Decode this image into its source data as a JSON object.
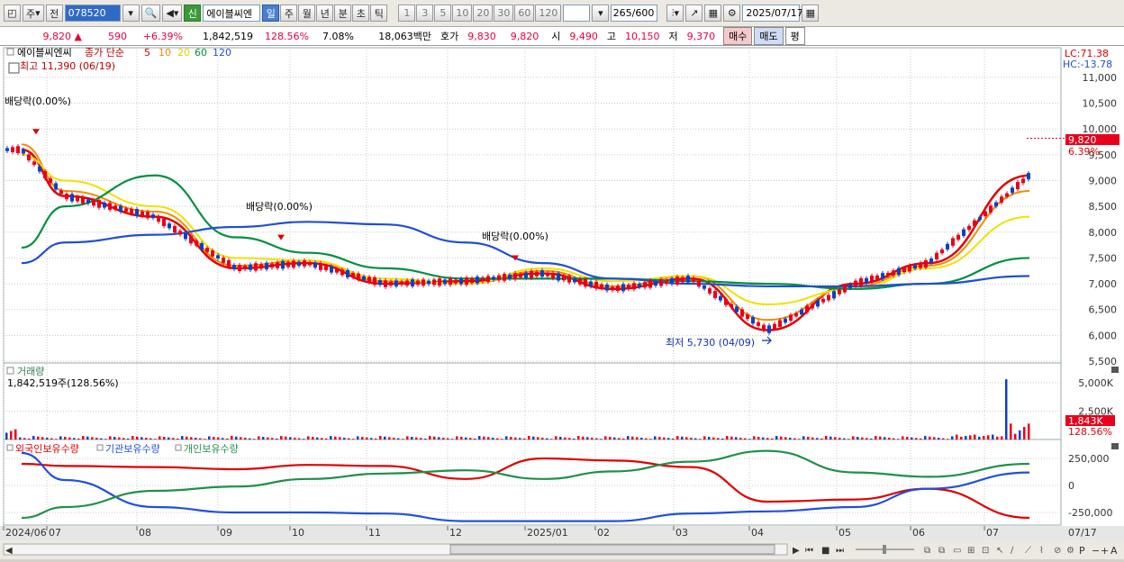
{
  "toolbar": {
    "period_label": "주",
    "prev_label": "전",
    "stock_code": "078520",
    "new_badge": "신",
    "stock_name": "에이블씨엔",
    "periods": [
      "일",
      "주",
      "월",
      "년",
      "분",
      "초",
      "틱"
    ],
    "active_period": "일",
    "intervals": [
      "1",
      "3",
      "5",
      "10",
      "20",
      "30",
      "60",
      "120"
    ],
    "count": "265",
    "count_total": "/600",
    "date": "2025/07/17"
  },
  "quote": {
    "price": "9,820",
    "change_arrow": "▲",
    "change": "590",
    "change_pct": "+6.39%",
    "volume": "1,842,519",
    "volume_ratio": "128.56%",
    "turnover": "7.08%",
    "amount": "18,063백만",
    "ask_label": "호가",
    "ask": "9,830",
    "bid": "9,820",
    "open_label": "시",
    "open": "9,490",
    "high_label": "고",
    "high": "10,150",
    "low_label": "저",
    "low": "9,370",
    "buy_label": "매수",
    "sell_label": "매도",
    "avg_label": "평"
  },
  "legend": {
    "name": "에이블씨엔씨",
    "ma_label": "종가 단순",
    "ma_periods": [
      "5",
      "10",
      "20",
      "60",
      "120"
    ],
    "ma_colors": [
      "#e00000",
      "#f08c00",
      "#f0e000",
      "#009040",
      "#2050d0"
    ]
  },
  "price_panel": {
    "lc_label": "LC:71.38",
    "hc_label": "HC:-13.78",
    "high_annotation": "최고 11,390 (06/19)",
    "low_annotation": "최저 5,730 (04/09)",
    "dividend_labels": [
      "배당락(0.00%)",
      "배당락(0.00%)",
      "배당락(0.00%)"
    ],
    "current_price_tag": "9,820",
    "current_pct_tag": "6.39%"
  },
  "volume_panel": {
    "title": "거래량",
    "value_label": "1,842,519주(128.56%)",
    "current_tag": "1,843K",
    "current_pct_tag": "128.56%"
  },
  "holdings_panel": {
    "series_labels": [
      "외국인보유수량",
      "기관보유수량",
      "개인보유수량"
    ],
    "series_colors": [
      "#e00000",
      "#2050e0",
      "#20904a"
    ]
  },
  "x_axis": {
    "labels": [
      "2024/06",
      "07",
      "08",
      "09",
      "10",
      "11",
      "12",
      "2025/01",
      "02",
      "03",
      "04",
      "05",
      "06",
      "07"
    ],
    "right_label": "07/17"
  },
  "chart_data": [
    {
      "type": "line",
      "title": "에이블씨엔씨",
      "ylim": [
        5500,
        11400
      ],
      "yticks": [
        5500,
        6000,
        6500,
        7000,
        7500,
        8000,
        8500,
        9000,
        9500,
        10000,
        10500,
        11000
      ],
      "ytick_labels": [
        "5,500",
        "6,000",
        "6,500",
        "7,000",
        "7,500",
        "8,000",
        "8,500",
        "9,000",
        "9,500",
        "10,000",
        "10,500",
        "11,000"
      ],
      "x": [
        "2024/06",
        "07",
        "08",
        "09",
        "10",
        "11",
        "12",
        "2025/01",
        "02",
        "03",
        "04",
        "05",
        "06",
        "07"
      ],
      "series": [
        {
          "name": "5",
          "values": [
            9600,
            8700,
            8300,
            7300,
            7400,
            7000,
            7050,
            7200,
            6900,
            7100,
            6100,
            7000,
            7400,
            9100
          ]
        },
        {
          "name": "10",
          "values": [
            9700,
            8800,
            8400,
            7350,
            7450,
            7050,
            7000,
            7250,
            6950,
            7150,
            6300,
            6950,
            7350,
            8800
          ]
        },
        {
          "name": "20",
          "values": [
            9500,
            9000,
            8500,
            7500,
            7450,
            7100,
            7000,
            7300,
            7050,
            7150,
            6600,
            6900,
            7300,
            8300
          ]
        },
        {
          "name": "60",
          "values": [
            7700,
            8500,
            9100,
            7900,
            7600,
            7300,
            7100,
            7100,
            7100,
            7050,
            7000,
            6900,
            7000,
            7500
          ]
        },
        {
          "name": "120",
          "values": [
            7400,
            7800,
            7950,
            8100,
            8200,
            8150,
            7800,
            7400,
            7100,
            7000,
            6950,
            6950,
            7000,
            7150
          ]
        }
      ],
      "last_close": 9820
    },
    {
      "type": "bar",
      "title": "거래량",
      "ylim": [
        0,
        6500000
      ],
      "yticks": [
        2500000,
        5000000
      ],
      "ytick_labels": [
        "2,500K",
        "5,000K"
      ],
      "spike_value": 5300000,
      "last_value": 1842519
    },
    {
      "type": "line",
      "ylim": [
        -350000,
        350000
      ],
      "yticks": [
        -250000,
        0,
        250000
      ],
      "ytick_labels": [
        "-250,000",
        "0",
        "250,000"
      ],
      "x": [
        "2024/06",
        "07",
        "08",
        "09",
        "10",
        "11",
        "12",
        "2025/01",
        "02",
        "03",
        "04",
        "05",
        "06",
        "07"
      ],
      "series": [
        {
          "name": "외국인보유수량",
          "values": [
            200000,
            180000,
            170000,
            150000,
            190000,
            180000,
            60000,
            250000,
            230000,
            170000,
            -150000,
            -130000,
            -30000,
            -300000
          ]
        },
        {
          "name": "기관보유수량",
          "values": [
            300000,
            50000,
            -200000,
            -250000,
            -250000,
            -260000,
            -330000,
            -330000,
            -330000,
            -260000,
            -240000,
            -200000,
            -30000,
            120000
          ]
        },
        {
          "name": "개인보유수량",
          "values": [
            -300000,
            -200000,
            -50000,
            -10000,
            60000,
            110000,
            140000,
            60000,
            130000,
            220000,
            320000,
            120000,
            80000,
            200000
          ]
        }
      ]
    }
  ]
}
